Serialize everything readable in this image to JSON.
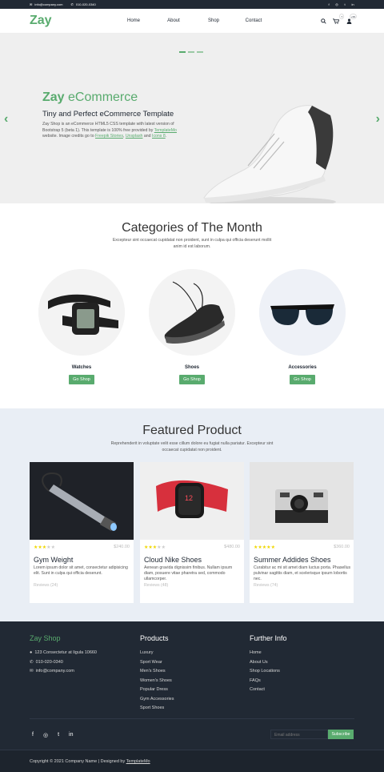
{
  "topbar": {
    "email": "info@company.com",
    "phone": "010-020-0340",
    "icons": [
      "facebook-icon",
      "instagram-icon",
      "twitter-icon",
      "linkedin-icon"
    ]
  },
  "header": {
    "logo": "Zay",
    "nav": [
      "Home",
      "About",
      "Shop",
      "Contact"
    ],
    "cart_count": "7",
    "user_count": "+99"
  },
  "hero": {
    "title_bold": "Zay",
    "title_rest": " eCommerce",
    "subtitle": "Tiny and Perfect eCommerce Template",
    "p1": "Zay Shop is an eCommerce HTML5 CSS template with latest version of Bootstrap 5 (beta 1). This template is 100% free provided by ",
    "link1": "TemplateMo",
    "p2": " website. Image credits go to ",
    "link2": "Freepik Stories",
    "sep": ", ",
    "link3": "Unsplash",
    "and": " and ",
    "link4": "Icons 8",
    "end": "."
  },
  "categories": {
    "title": "Categories of The Month",
    "subtitle": "Excepteur sint occaecat cupidatat non proident, sunt in culpa qui officia deserunt mollit anim id est laborum.",
    "items": [
      {
        "name": "Watches",
        "button": "Go Shop"
      },
      {
        "name": "Shoes",
        "button": "Go Shop"
      },
      {
        "name": "Accessories",
        "button": "Go Shop"
      }
    ]
  },
  "featured": {
    "title": "Featured Product",
    "subtitle": "Reprehenderit in voluptate velit esse cillum dolore eu fugiat nulla pariatur. Excepteur sint occaecat cupidatat non proident.",
    "products": [
      {
        "title": "Gym Weight",
        "price": "$240.00",
        "rating": 3,
        "desc": "Lorem ipsum dolor sit amet, consectetur adipisicing elit. Sunt in culpa qui officia deserunt.",
        "reviews": "Reviews (24)"
      },
      {
        "title": "Cloud Nike Shoes",
        "price": "$480.00",
        "rating": 3,
        "desc": "Aenean gravida dignissim finibus. Nullam ipsum diam, posuere vitae pharetra sed, commodo ullamcorper.",
        "reviews": "Reviews (48)"
      },
      {
        "title": "Summer Addides Shoes",
        "price": "$360.00",
        "rating": 5,
        "desc": "Curabitur ac mi sit amet diam luctus porta. Phasellus pulvinar sagittis diam, et scelerisque ipsum lobortis nec.",
        "reviews": "Reviews (74)"
      }
    ]
  },
  "footer": {
    "brand": "Zay Shop",
    "address": "123 Consectetur at ligula 10660",
    "phone": "010-020-0340",
    "email": "info@company.com",
    "products_title": "Products",
    "products": [
      "Luxury",
      "Sport Wear",
      "Men's Shoes",
      "Women's Shoes",
      "Popular Dress",
      "Gym Accessories",
      "Sport Shoes"
    ],
    "info_title": "Further Info",
    "info": [
      "Home",
      "About Us",
      "Shop Locations",
      "FAQs",
      "Contact"
    ],
    "email_placeholder": "Email address",
    "subscribe": "Subscribe",
    "copyright": "Copyright © 2021 Company Name | Designed by ",
    "designer": "TemplateMo"
  }
}
